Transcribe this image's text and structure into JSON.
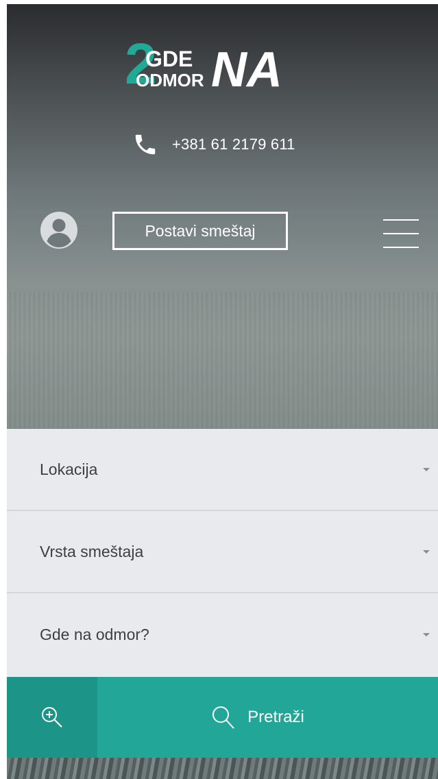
{
  "brand": {
    "logo_small_top": "GDE",
    "logo_small_bottom": "ODMOR",
    "logo_large": "NA",
    "logo_digit": "2"
  },
  "header": {
    "phone": "+381 61 2179 611",
    "post_button_label": "Postavi smeštaj"
  },
  "search_form": {
    "fields": [
      {
        "label": "Lokacija"
      },
      {
        "label": "Vrsta smeštaja"
      },
      {
        "label": "Gde na odmor?"
      }
    ],
    "submit_label": "Pretraži"
  },
  "icons": {
    "phone": "phone-icon",
    "user": "user-avatar-icon",
    "menu": "hamburger-menu-icon",
    "advanced": "zoom-in-icon",
    "search": "search-icon",
    "caret": "caret-down-icon"
  },
  "colors": {
    "accent": "#21a697",
    "accent_dark": "#1d9488",
    "form_bg": "#e8eaed",
    "text": "#3d3f41"
  }
}
